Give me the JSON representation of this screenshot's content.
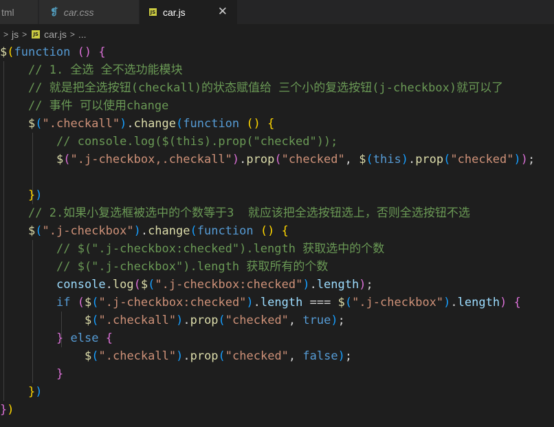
{
  "tabs": [
    {
      "label": "tml"
    },
    {
      "label": "car.css",
      "icon": "css-icon"
    },
    {
      "label": "car.js",
      "icon": "js-icon",
      "active": true
    }
  ],
  "breadcrumb": {
    "parts": [
      "js",
      "car.js",
      "..."
    ]
  },
  "code_lines": [
    "$(function () {",
    "    // 1. 全选 全不选功能模块",
    "    // 就是把全选按钮(checkall)的状态赋值给 三个小的复选按钮(j-checkbox)就可以了",
    "    // 事件 可以使用change",
    "    $(\".checkall\").change(function () {",
    "        // console.log($(this).prop(\"checked\"));",
    "        $(\".j-checkbox,.checkall\").prop(\"checked\", $(this).prop(\"checked\"));",
    "",
    "    })",
    "    // 2.如果小复选框被选中的个数等于3  就应该把全选按钮选上，否则全选按钮不选",
    "    $(\".j-checkbox\").change(function () {",
    "        // $(\".j-checkbox:checked\").length 获取选中的个数",
    "        // $(\".j-checkbox\").length 获取所有的个数",
    "        console.log($(\".j-checkbox:checked\").length);",
    "        if ($(\".j-checkbox:checked\").length === $(\".j-checkbox\").length) {",
    "            $(\".checkall\").prop(\"checked\", true);",
    "        } else {",
    "            $(\".checkall\").prop(\"checked\", false);",
    "        }",
    "    })",
    "})"
  ],
  "colors": {
    "background": "#1e1e1e",
    "comment": "#6a9955",
    "keyword": "#569cd6",
    "string": "#ce9178",
    "function": "#dcdcaa"
  }
}
